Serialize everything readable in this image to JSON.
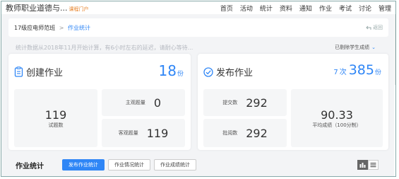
{
  "topbar": {
    "title": "教师职业道德与...",
    "subtitle": "课程门户",
    "nav": [
      "首页",
      "活动",
      "统计",
      "资料",
      "通知",
      "作业",
      "考试",
      "讨论",
      "管理"
    ]
  },
  "breadcrumb": {
    "class": "17级应电师范班",
    "separator": ">",
    "current": "作业统计",
    "back": "返回"
  },
  "notice": "统计数据从2018年11月开始计算，有6小时左右的延迟，请耐心等待...",
  "filter": {
    "label": "已剔除学生成绩",
    "chev": "⌄"
  },
  "create": {
    "title": "创建作业",
    "count": "18",
    "unit": "份",
    "total": "119",
    "total_label": "试题数",
    "subjective_label": "主观题量",
    "subjective": "0",
    "objective_label": "客观题量",
    "objective": "119"
  },
  "publish": {
    "title": "发布作业",
    "times": "7",
    "times_unit": "次",
    "count": "385",
    "unit": "份",
    "submitted_label": "提交数",
    "submitted": "292",
    "graded_label": "批阅数",
    "graded": "292",
    "avg": "90.33",
    "avg_label": "平均成绩（100分制）"
  },
  "section": {
    "title": "作业统计",
    "tabs": [
      "发布作业统计",
      "作业情况统计",
      "作业成绩统计"
    ]
  },
  "colors": {
    "accent": "#2f86f6"
  }
}
